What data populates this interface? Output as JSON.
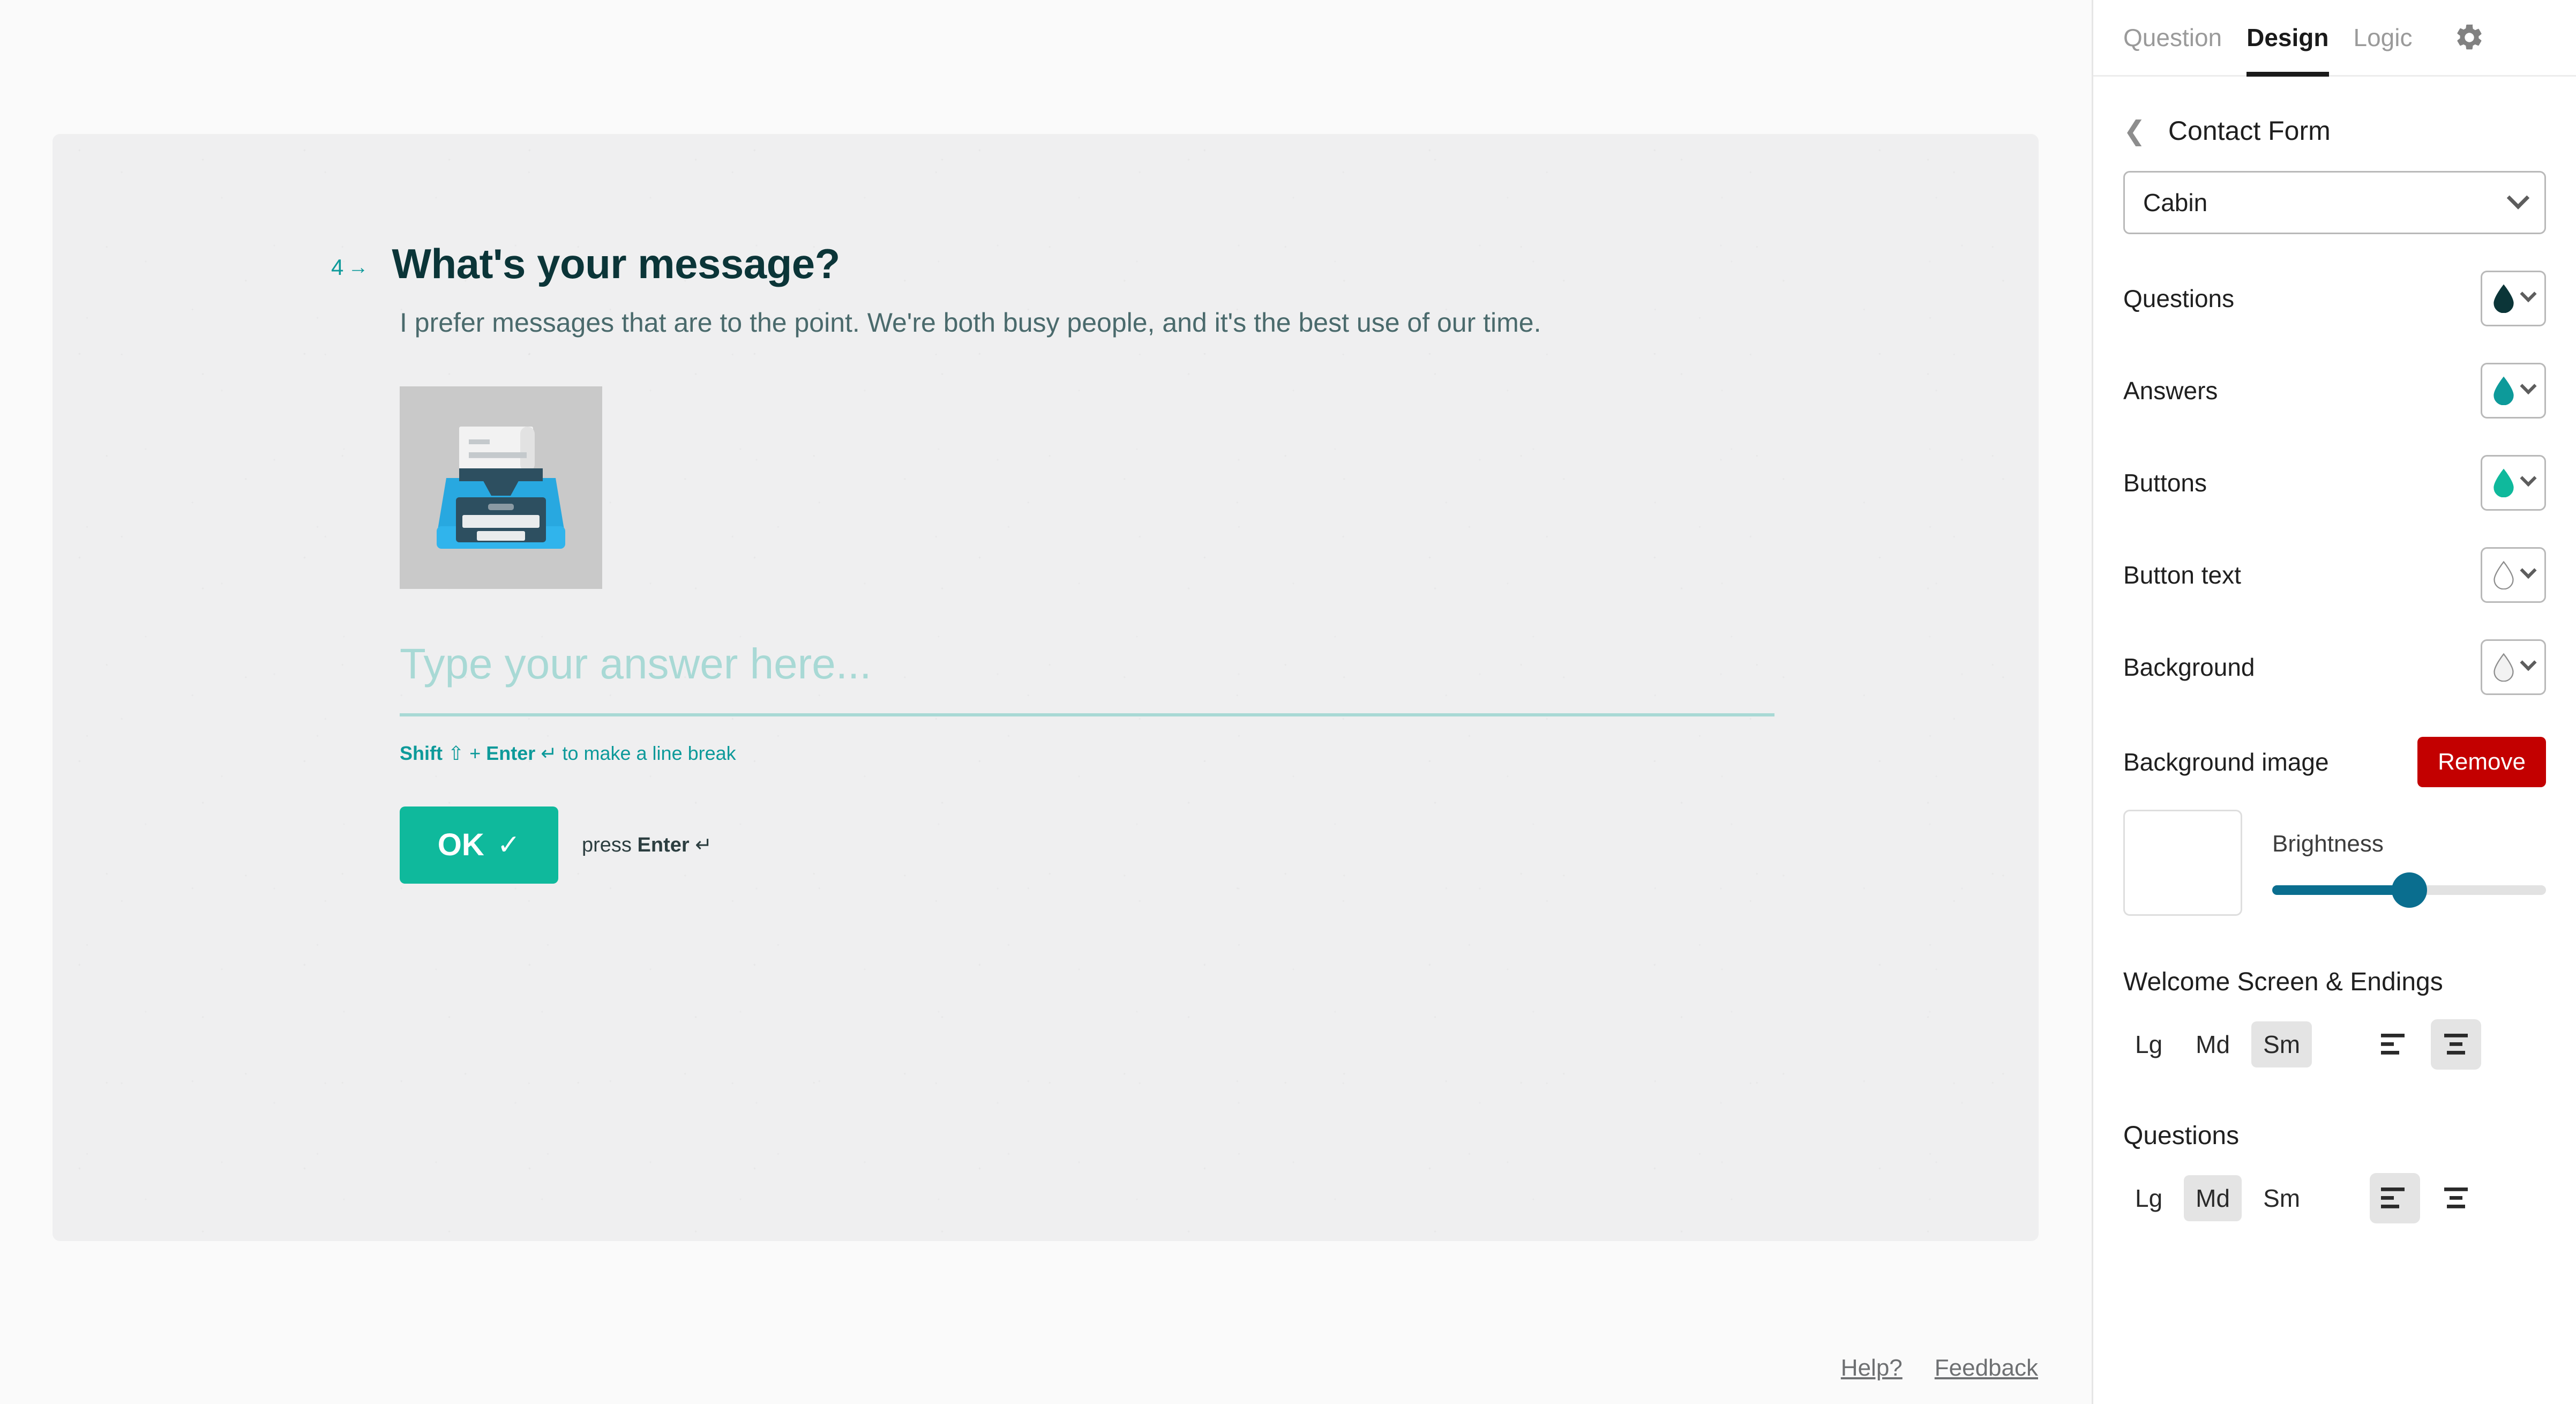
{
  "panel": {
    "tabs": [
      {
        "label": "Question",
        "active": false
      },
      {
        "label": "Design",
        "active": true
      },
      {
        "label": "Logic",
        "active": false
      }
    ],
    "settings_icon": "gear-icon",
    "breadcrumb": {
      "back_icon": "chevron-left-icon",
      "title": "Contact Form"
    },
    "theme_select": {
      "value": "Cabin",
      "chevron": "chevron-down-icon"
    },
    "colors": [
      {
        "label": "Questions",
        "hex": "#0b3538",
        "outline": false
      },
      {
        "label": "Answers",
        "hex": "#0d9a9a",
        "outline": false
      },
      {
        "label": "Buttons",
        "hex": "#0fb99c",
        "outline": false
      },
      {
        "label": "Button text",
        "hex": "#ffffff",
        "outline": true
      },
      {
        "label": "Background",
        "hex": "#f2f2f2",
        "outline": true
      }
    ],
    "background_image": {
      "label": "Background image",
      "remove_label": "Remove",
      "remove_color": "#c30000",
      "thumb_color": "#ffffff"
    },
    "brightness": {
      "label": "Brightness",
      "value_percent": 50,
      "track_color": "#0a6e8f"
    },
    "welcome_section": {
      "title": "Welcome Screen & Endings",
      "sizes": [
        "Lg",
        "Md",
        "Sm"
      ],
      "selected_size": "Sm",
      "aligns": [
        "align-left",
        "align-center"
      ],
      "selected_align": "align-center"
    },
    "questions_section": {
      "title": "Questions",
      "sizes": [
        "Lg",
        "Md",
        "Sm"
      ],
      "selected_size": "Md",
      "aligns": [
        "align-left",
        "align-center"
      ],
      "selected_align": "align-left"
    }
  },
  "preview": {
    "question": {
      "number": "4",
      "arrow": "→",
      "title": "What's your message?",
      "description": "I prefer messages that are to the point. We're both busy people, and it's the best use of our time.",
      "image_icon": "typewriter-image"
    },
    "answer": {
      "placeholder": "Type your answer here...",
      "value": "",
      "hint_shift": "Shift",
      "hint_shift_glyph": "⇧",
      "hint_plus": "+",
      "hint_enter": "Enter",
      "hint_enter_glyph": "↵",
      "hint_tail": "to make a line break"
    },
    "submit": {
      "ok_label": "OK",
      "check_glyph": "✓",
      "press_prefix": "press",
      "press_key": "Enter",
      "press_glyph": "↵"
    },
    "footer": {
      "help": "Help?",
      "feedback": "Feedback"
    }
  },
  "theme_colors": {
    "question_text": "#0b3538",
    "description_text": "#4a6a6c",
    "answer_accent": "#a8d9d5",
    "button_bg": "#0fb99c",
    "card_bg": "#efeff0",
    "page_bg": "#fafafa"
  }
}
